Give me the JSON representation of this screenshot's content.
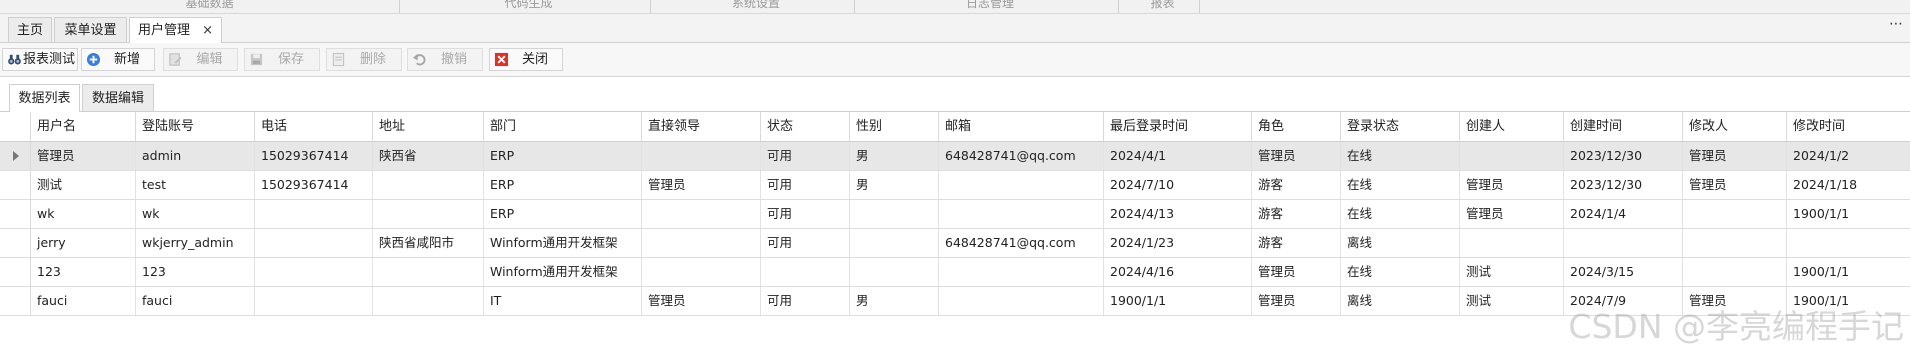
{
  "top_menu": [
    "基础数据",
    "代码生成",
    "系统设置",
    "日志管理",
    "报表"
  ],
  "doc_tabs": [
    {
      "label": "主页",
      "active": false
    },
    {
      "label": "菜单设置",
      "active": false
    },
    {
      "label": "用户管理",
      "active": true,
      "close": "×"
    }
  ],
  "more_menu": "⋯",
  "toolbar": {
    "report_test": "报表测试",
    "add": "新增",
    "edit": "编辑",
    "save": "保存",
    "delete": "删除",
    "undo": "撤销",
    "close": "关闭"
  },
  "sub_tabs": [
    {
      "label": "数据列表",
      "active": true
    },
    {
      "label": "数据编辑",
      "active": false
    }
  ],
  "table": {
    "columns": [
      "用户名",
      "登陆账号",
      "电话",
      "地址",
      "部门",
      "直接领导",
      "状态",
      "性别",
      "邮箱",
      "最后登录时间",
      "角色",
      "登录状态",
      "创建人",
      "创建时间",
      "修改人",
      "修改时间"
    ],
    "rows": [
      [
        "管理员",
        "admin",
        "15029367414",
        "陕西省",
        "ERP",
        "",
        "可用",
        "男",
        "648428741@qq.com",
        "2024/4/1",
        "管理员",
        "在线",
        "",
        "2023/12/30",
        "管理员",
        "2024/1/2"
      ],
      [
        "测试",
        "test",
        "15029367414",
        "",
        "ERP",
        "管理员",
        "可用",
        "男",
        "",
        "2024/7/10",
        "游客",
        "在线",
        "管理员",
        "2023/12/30",
        "管理员",
        "2024/1/18"
      ],
      [
        "wk",
        "wk",
        "",
        "",
        "ERP",
        "",
        "可用",
        "",
        "",
        "2024/4/13",
        "游客",
        "在线",
        "管理员",
        "2024/1/4",
        "",
        "1900/1/1"
      ],
      [
        "jerry",
        "wkjerry_admin",
        "",
        "陕西省咸阳市",
        "Winform通用开发框架",
        "",
        "可用",
        "",
        "648428741@qq.com",
        "2024/1/23",
        "游客",
        "离线",
        "",
        "",
        "",
        ""
      ],
      [
        "123",
        "123",
        "",
        "",
        "Winform通用开发框架",
        "",
        "",
        "",
        "",
        "2024/4/16",
        "管理员",
        "在线",
        "测试",
        "2024/3/15",
        "",
        "1900/1/1"
      ],
      [
        "fauci",
        "fauci",
        "",
        "",
        "IT",
        "管理员",
        "可用",
        "男",
        "",
        "1900/1/1",
        "管理员",
        "离线",
        "测试",
        "2024/7/9",
        "管理员",
        "1900/1/1"
      ]
    ],
    "selected_row": 0
  },
  "watermark": "CSDN @李亮编程手记"
}
